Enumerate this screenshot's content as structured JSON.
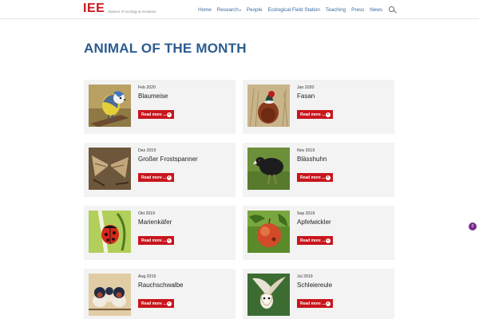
{
  "header": {
    "logo": "IEE",
    "logo_sub": "division of ecology & evolution",
    "nav": [
      {
        "label": "Home"
      },
      {
        "label": "Research",
        "caret": "▾"
      },
      {
        "label": "People"
      },
      {
        "label": "Ecological Field Station"
      },
      {
        "label": "Teaching"
      },
      {
        "label": "Press"
      },
      {
        "label": "News"
      }
    ]
  },
  "page_title": "ANIMAL OF THE MONTH",
  "read_more_label": "Read more ...",
  "cards": [
    {
      "date": "Feb 2020",
      "title": "Blaumeise",
      "image": "blue-tit"
    },
    {
      "date": "Jan 2020",
      "title": "Fasan",
      "image": "pheasant"
    },
    {
      "date": "Dez 2019",
      "title": "Großer Frostspanner",
      "image": "moth"
    },
    {
      "date": "Nov 2019",
      "title": "Blässhuhn",
      "image": "coot"
    },
    {
      "date": "Okt 2019",
      "title": "Marienkäfer",
      "image": "ladybird"
    },
    {
      "date": "Sep 2019",
      "title": "Apfelwickler",
      "image": "apple"
    },
    {
      "date": "Aug 2019",
      "title": "Rauchschwalbe",
      "image": "swallows"
    },
    {
      "date": "Jul 2019",
      "title": "Schleiereule",
      "image": "barn-owl"
    }
  ],
  "fab_label": "0"
}
